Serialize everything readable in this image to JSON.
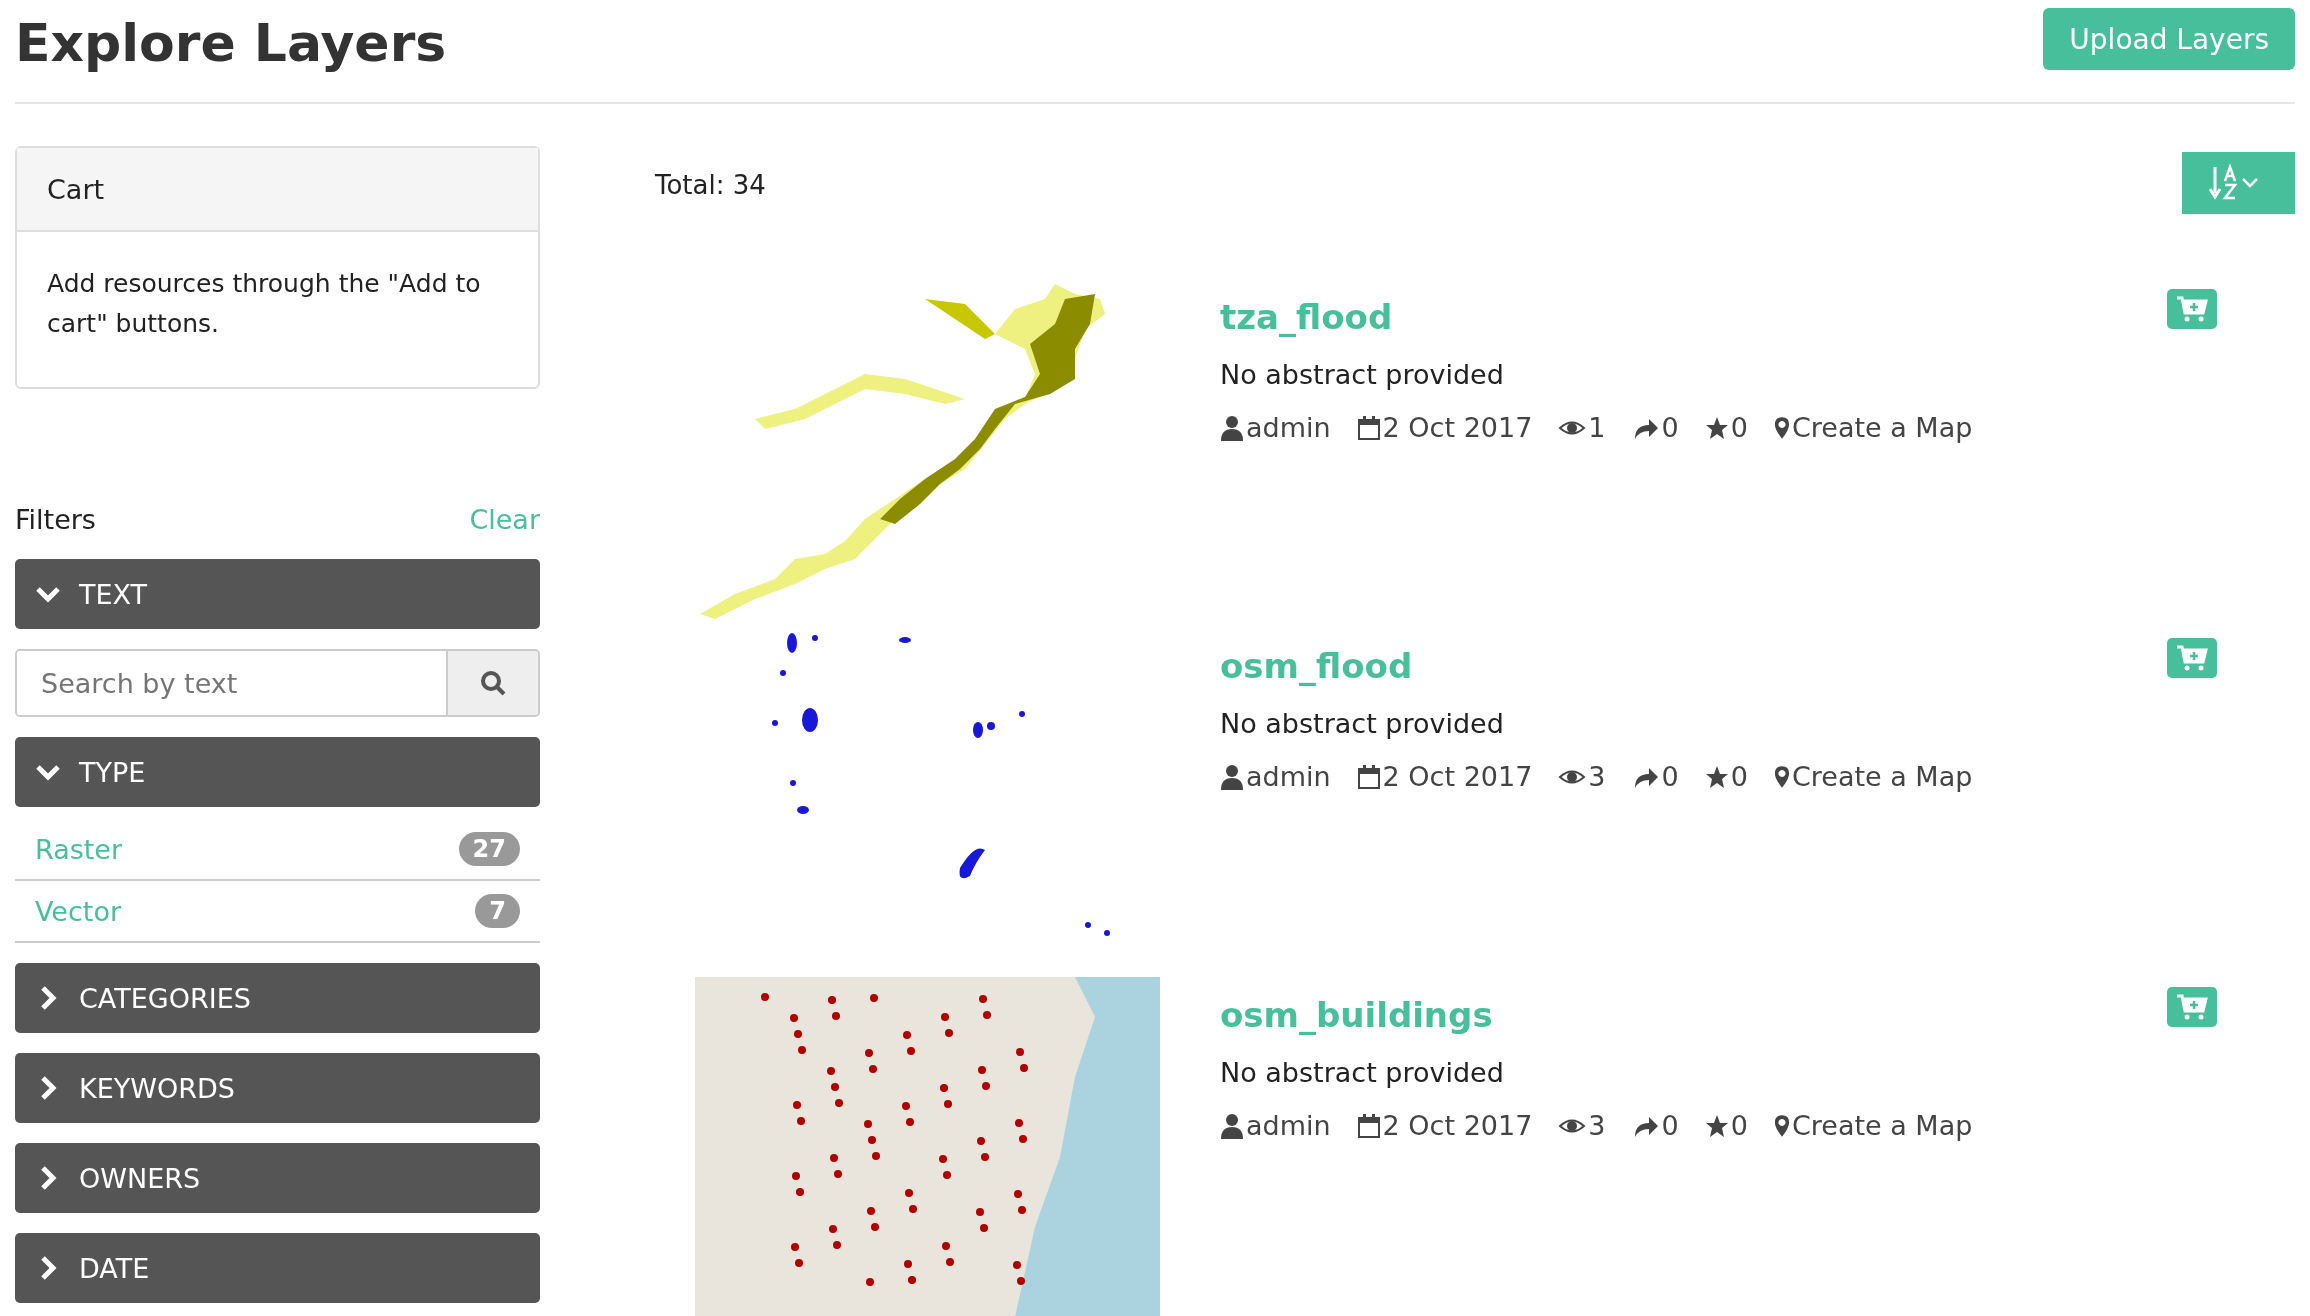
{
  "page_title": "Explore Layers",
  "upload_button": "Upload Layers",
  "cart": {
    "title": "Cart",
    "message": "Add resources through the \"Add to cart\" buttons."
  },
  "filters": {
    "title": "Filters",
    "clear": "Clear",
    "sections": [
      {
        "kind": "search",
        "label": "TEXT",
        "expanded": true,
        "placeholder": "Search by text"
      },
      {
        "kind": "list",
        "label": "TYPE",
        "expanded": true,
        "items": [
          {
            "label": "Raster",
            "count": "27"
          },
          {
            "label": "Vector",
            "count": "7"
          }
        ]
      },
      {
        "label": "CATEGORIES",
        "expanded": false
      },
      {
        "label": "KEYWORDS",
        "expanded": false
      },
      {
        "label": "OWNERS",
        "expanded": false
      },
      {
        "label": "DATE",
        "expanded": false
      }
    ]
  },
  "total": "Total: 34",
  "layers": [
    {
      "kind": "flood",
      "title": "tza_flood",
      "abstract": "No abstract provided",
      "owner": "admin",
      "date": "2 Oct 2017",
      "views": "1",
      "shares": "0",
      "stars_count": "0",
      "map_link": "Create a Map"
    },
    {
      "kind": "points",
      "title": "osm_flood",
      "abstract": "No abstract provided",
      "owner": "admin",
      "date": "2 Oct 2017",
      "views": "3",
      "shares": "0",
      "stars_count": "0",
      "map_link": "Create a Map"
    },
    {
      "kind": "map",
      "title": "osm_buildings",
      "abstract": "No abstract provided",
      "owner": "admin",
      "date": "2 Oct 2017",
      "views": "3",
      "shares": "0",
      "stars_count": "0",
      "map_link": "Create a Map"
    }
  ]
}
